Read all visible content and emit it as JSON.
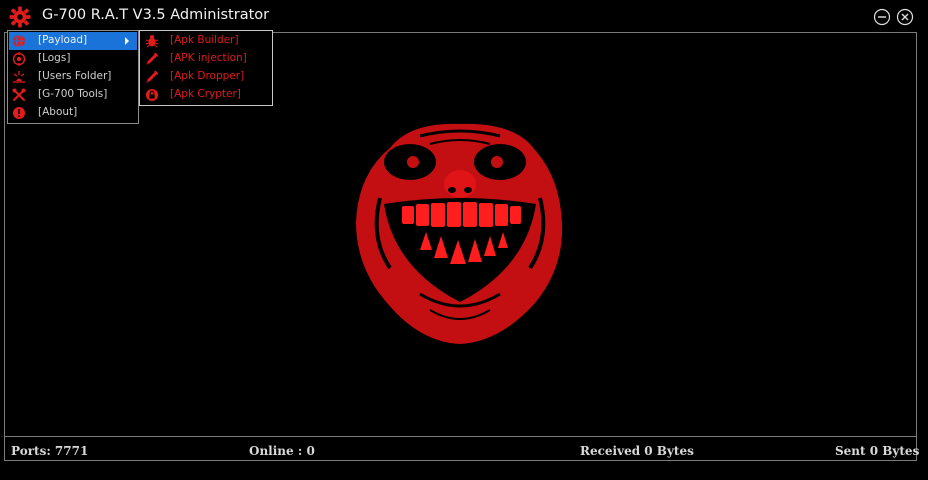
{
  "window": {
    "title": "G-700 R.A.T V3.5 Administrator"
  },
  "menu": {
    "items": [
      {
        "label": "[Payload]",
        "icon": "globe-icon",
        "selected": true
      },
      {
        "label": "[Logs]",
        "icon": "target-icon"
      },
      {
        "label": "[Users Folder]",
        "icon": "sparkle-icon"
      },
      {
        "label": "[G-700 Tools]",
        "icon": "tools-icon"
      },
      {
        "label": "[About]",
        "icon": "info-icon"
      }
    ]
  },
  "submenu": {
    "items": [
      {
        "label": "[Apk Builder]",
        "icon": "bug-icon"
      },
      {
        "label": "[APK injection]",
        "icon": "syringe-icon"
      },
      {
        "label": "[Apk Dropper]",
        "icon": "syringe-icon"
      },
      {
        "label": "[Apk Crypter]",
        "icon": "lock-icon"
      }
    ]
  },
  "status": {
    "ports": "Ports: 7771",
    "online": "Online : 0",
    "received": "Received 0 Bytes",
    "sent": "Sent 0 Bytes"
  },
  "colors": {
    "accent": "#e21b1b",
    "menu_highlight": "#1a73d9",
    "background": "#000000"
  }
}
